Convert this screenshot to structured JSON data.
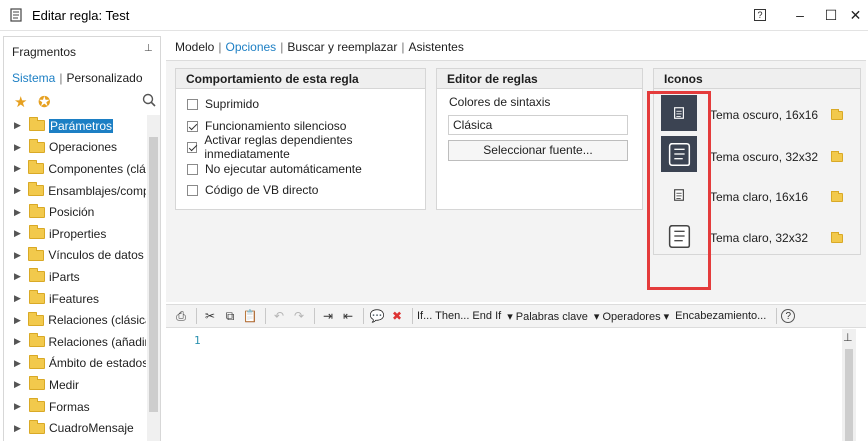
{
  "window": {
    "title": "Editar regla: Test",
    "help_glyph": "?",
    "min_glyph": "–",
    "max_glyph": "☐",
    "close_glyph": "✕"
  },
  "left_panel": {
    "header": "Fragmentos",
    "pin_glyph": "⊥",
    "tab_system": "Sistema",
    "tab_separator": "|",
    "tab_custom": "Personalizado",
    "items": [
      {
        "label": "Parámetros",
        "selected": true
      },
      {
        "label": "Operaciones"
      },
      {
        "label": "Componentes (clási"
      },
      {
        "label": "Ensamblajes/compo"
      },
      {
        "label": "Posición"
      },
      {
        "label": "iProperties"
      },
      {
        "label": "Vínculos de datos d"
      },
      {
        "label": "iParts"
      },
      {
        "label": "iFeatures"
      },
      {
        "label": "Relaciones (clásica)"
      },
      {
        "label": "Relaciones (añadir)"
      },
      {
        "label": "Ámbito de estados"
      },
      {
        "label": "Medir"
      },
      {
        "label": "Formas"
      },
      {
        "label": "CuadroMensaje"
      }
    ]
  },
  "tabs": {
    "modelo": "Modelo",
    "opciones": "Opciones",
    "buscar": "Buscar y reemplazar",
    "asistentes": "Asistentes",
    "separator": "|",
    "active": "Opciones"
  },
  "behavior": {
    "title": "Comportamiento de esta regla",
    "options": [
      {
        "label": "Suprimido",
        "checked": false
      },
      {
        "label": "Funcionamiento silencioso",
        "checked": true
      },
      {
        "label": "Activar reglas dependientes inmediatamente",
        "checked": true
      },
      {
        "label": "No ejecutar automáticamente",
        "checked": false
      },
      {
        "label": "Código de VB directo",
        "checked": false
      }
    ]
  },
  "editor": {
    "title": "Editor de reglas",
    "syntax_label": "Colores de sintaxis",
    "syntax_value": "Clásica",
    "font_button": "Seleccionar fuente..."
  },
  "icons": {
    "title": "Iconos",
    "items": [
      {
        "label": "Tema oscuro, 16x16",
        "theme": "dark",
        "size": "small"
      },
      {
        "label": "Tema oscuro, 32x32",
        "theme": "dark",
        "size": "large"
      },
      {
        "label": "Tema claro, 16x16",
        "theme": "light",
        "size": "small"
      },
      {
        "label": "Tema claro, 32x32",
        "theme": "light",
        "size": "large"
      }
    ],
    "highlight_color": "#e43b3b"
  },
  "toolbar": {
    "if_then": "If... Then... End If",
    "keywords": "Palabras clave",
    "operators": "Operadores",
    "header": "Encabezamiento...",
    "help_glyph": "?"
  },
  "code": {
    "line_numbers": [
      "1"
    ]
  },
  "colors": {
    "accent": "#1c7fc4",
    "dark_icon_bg": "#3b4352"
  }
}
